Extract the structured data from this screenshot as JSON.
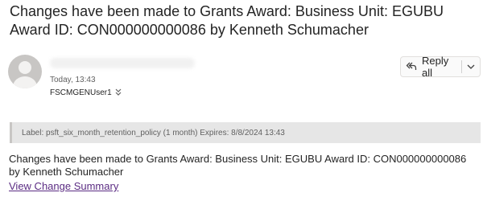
{
  "email": {
    "subject": "Changes have been made to Grants Award: Business Unit: EGUBU Award ID: CON000000000086 by Kenneth Schumacher",
    "date": "Today, 13:43",
    "recipient": "FSCMGENUser1",
    "recipient_expand_icon": "chevron-double-down-icon",
    "reply_all_label": "Reply all",
    "reply_icon": "reply-all-icon",
    "reply_dropdown_icon": "chevron-down-icon",
    "retention_label": "Label: psft_six_month_retention_policy (1 month) Expires: 8/8/2024 13:43",
    "body": "Changes have been made to Grants Award: Business Unit: EGUBU Award ID: CON000000000086 by Kenneth Schumacher",
    "link_text": "View Change Summary"
  },
  "colors": {
    "link": "#5b2c83",
    "label_bar_bg": "#e6e6e6",
    "avatar_bg": "#c8c6c4"
  }
}
